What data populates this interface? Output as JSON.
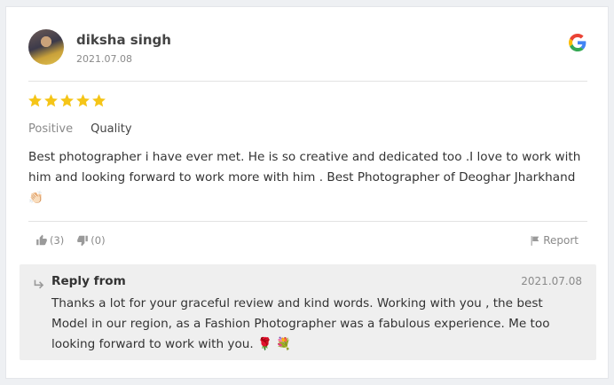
{
  "review": {
    "author": "diksha singh",
    "date": "2021.07.08",
    "rating": 5,
    "rating_max": 5,
    "source_icon": "google-g-icon",
    "tags": [
      "Positive",
      "Quality"
    ],
    "text": "Best photographer i have ever met. He is so creative and dedicated too .I love to work with him and looking forward to work more with him . Best Photographer of Deoghar Jharkhand 👏🏻",
    "likes": "(3)",
    "dislikes": "(0)",
    "report_label": "Report"
  },
  "reply": {
    "title": "Reply from",
    "date": "2021.07.08",
    "text": "Thanks a lot for your graceful review and kind words. Working with you , the best Model in our region, as a Fashion Photographer was a fabulous experience. Me too looking forward to work with you. 🌹 💐"
  },
  "colors": {
    "star": "#f5c518",
    "icon_gray": "#9a9a9a",
    "reply_bg": "#efefef"
  }
}
